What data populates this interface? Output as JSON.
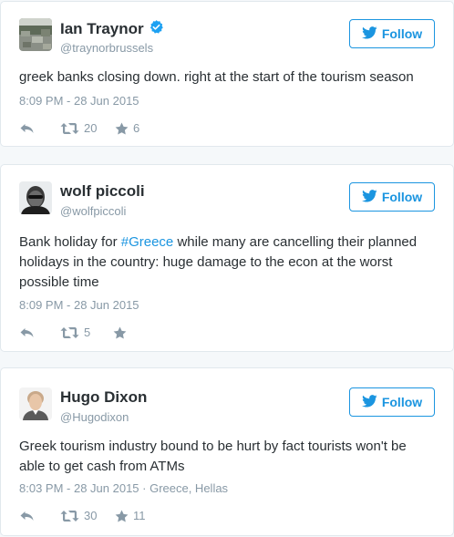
{
  "tweets": [
    {
      "name": "Ian Traynor",
      "verified": true,
      "handle": "@traynorbrussels",
      "follow_label": "Follow",
      "text": "greek banks closing down. right at the start of the tourism season",
      "timestamp": "8:09 PM - 28 Jun 2015",
      "retweets": "20",
      "favorites": "6"
    },
    {
      "name": "wolf piccoli",
      "verified": false,
      "handle": "@wolfpiccoli",
      "follow_label": "Follow",
      "text_before": "Bank holiday for ",
      "hashtag": "#Greece",
      "text_after": " while many are cancelling their planned holidays in the country: huge damage to the econ at the worst possible time",
      "timestamp": "8:09 PM - 28 Jun 2015",
      "retweets": "5",
      "favorites": ""
    },
    {
      "name": "Hugo Dixon",
      "verified": false,
      "handle": "@Hugodixon",
      "follow_label": "Follow",
      "text": "Greek tourism industry bound to be hurt by fact tourists won't be able to get cash from ATMs",
      "timestamp": "8:03 PM - 28 Jun 2015 · Greece, Hellas",
      "retweets": "30",
      "favorites": "11"
    }
  ],
  "icons": {
    "reply": "reply-icon",
    "retweet": "retweet-icon",
    "favorite": "star-icon",
    "follow": "twitter-bird-icon",
    "verified": "verified-badge-icon"
  },
  "colors": {
    "accent": "#1b95e0",
    "muted": "#8899a6",
    "text": "#292f33",
    "border": "#e1e8ed",
    "background": "#f5f8fa"
  }
}
